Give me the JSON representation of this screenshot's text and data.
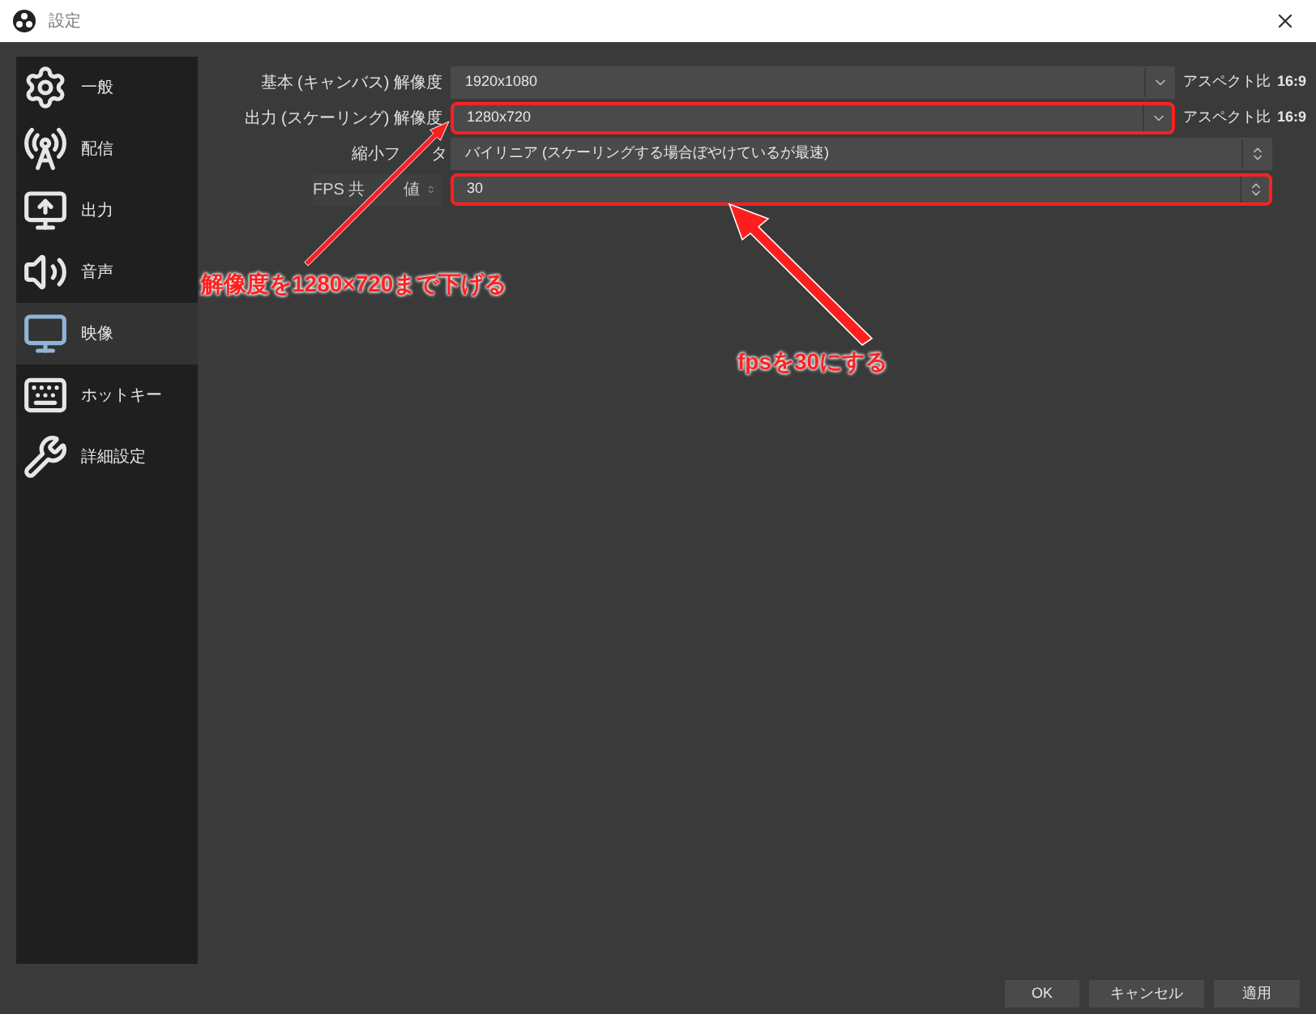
{
  "window": {
    "title": "設定"
  },
  "sidebar": {
    "items": [
      {
        "kind": "general",
        "label": "一般",
        "selected": false
      },
      {
        "kind": "stream",
        "label": "配信",
        "selected": false
      },
      {
        "kind": "output",
        "label": "出力",
        "selected": false
      },
      {
        "kind": "audio",
        "label": "音声",
        "selected": false
      },
      {
        "kind": "video",
        "label": "映像",
        "selected": true
      },
      {
        "kind": "hotkeys",
        "label": "ホットキー",
        "selected": false
      },
      {
        "kind": "advanced",
        "label": "詳細設定",
        "selected": false
      }
    ]
  },
  "video_settings": {
    "rows": [
      {
        "kind": "combo",
        "label": "基本 (キャンバス) 解像度",
        "value": "1920x1080",
        "aspect_label": "アスペクト比",
        "aspect_value": "16:9",
        "highlighted": false
      },
      {
        "kind": "combo",
        "label": "出力 (スケーリング) 解像度",
        "value": "1280x720",
        "aspect_label": "アスペクト比",
        "aspect_value": "16:9",
        "highlighted": true
      },
      {
        "kind": "select",
        "label": [
          "縮小フ",
          "タ"
        ],
        "value": "バイリニア (スケーリングする場合ぼやけているが最速)",
        "highlighted": false
      },
      {
        "kind": "fps",
        "label": [
          "FPS 共",
          "値"
        ],
        "value": "30",
        "highlighted": true
      }
    ]
  },
  "annotations": [
    {
      "text": "解像度を1280×720まで下げる"
    },
    {
      "text": "fpsを30にする"
    }
  ],
  "buttons": [
    "OK",
    "キャンセル",
    "適用"
  ]
}
